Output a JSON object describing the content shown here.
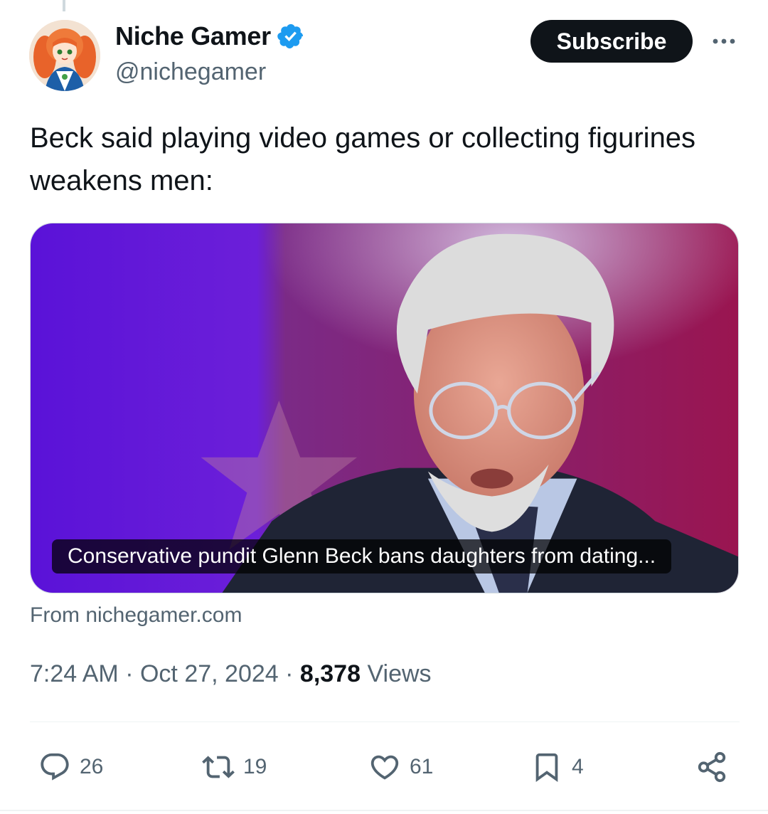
{
  "author": {
    "display_name": "Niche Gamer",
    "handle": "@nichegamer",
    "verified": true,
    "accent_color": "#1d9bf0"
  },
  "header": {
    "subscribe_label": "Subscribe",
    "more_icon": "more-horizontal-icon"
  },
  "tweet": {
    "text": "Beck said playing video games or collecting figurines weakens men:"
  },
  "card": {
    "caption": "Conservative pundit Glenn Beck bans daughters from dating...",
    "source": "From nichegamer.com"
  },
  "meta": {
    "time": "7:24 AM",
    "date": "Oct 27, 2024",
    "separator": "·",
    "views_count": "8,378",
    "views_label": "Views"
  },
  "actions": {
    "replies": "26",
    "reposts": "19",
    "likes": "61",
    "bookmarks": "4"
  },
  "colors": {
    "text": "#0f1419",
    "secondary": "#536471",
    "subscribe_bg": "#0f1419"
  }
}
